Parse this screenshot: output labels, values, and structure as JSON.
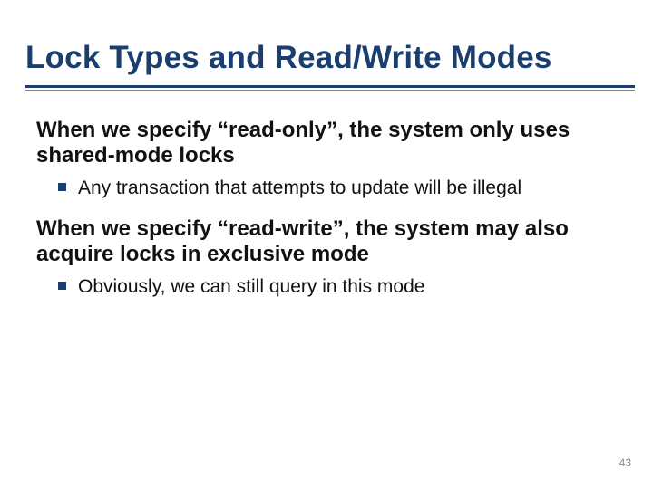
{
  "title": "Lock Types and Read/Write Modes",
  "body1": "When we specify “read-only”, the system only uses shared-mode locks",
  "sub1": "Any transaction that attempts to update will be illegal",
  "body2": "When we specify “read-write”, the system may also acquire locks in exclusive mode",
  "sub2": "Obviously, we can still query in this mode",
  "pageNumber": "43"
}
